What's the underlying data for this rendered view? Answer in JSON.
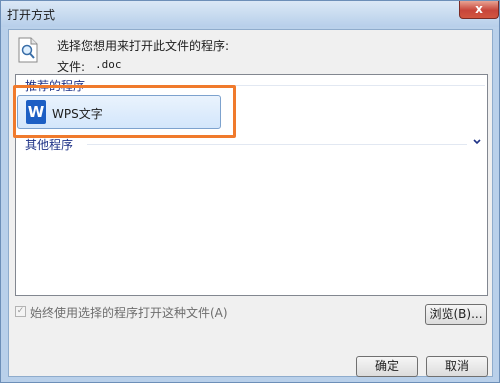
{
  "window": {
    "title": "打开方式",
    "close_glyph": "x"
  },
  "prompt": {
    "text": "选择您想用来打开此文件的程序:",
    "file_label": "文件:",
    "file_value": ".doc"
  },
  "programs": {
    "recommended_header": "推荐的程序",
    "recommended": [
      {
        "name": "WPS文字",
        "icon": "wps-writer-icon",
        "icon_letter": "W",
        "icon_color": "#1d5fc4"
      }
    ],
    "other_header": "其他程序"
  },
  "options": {
    "always_use_label": "始终使用选择的程序打开这种文件(A)",
    "always_use_checked": true
  },
  "buttons": {
    "browse": "浏览(B)...",
    "ok": "确定",
    "cancel": "取消"
  },
  "colors": {
    "highlight": "#f07a2c",
    "group_header": "#1e3287",
    "title_bar": "#b7cfea"
  }
}
